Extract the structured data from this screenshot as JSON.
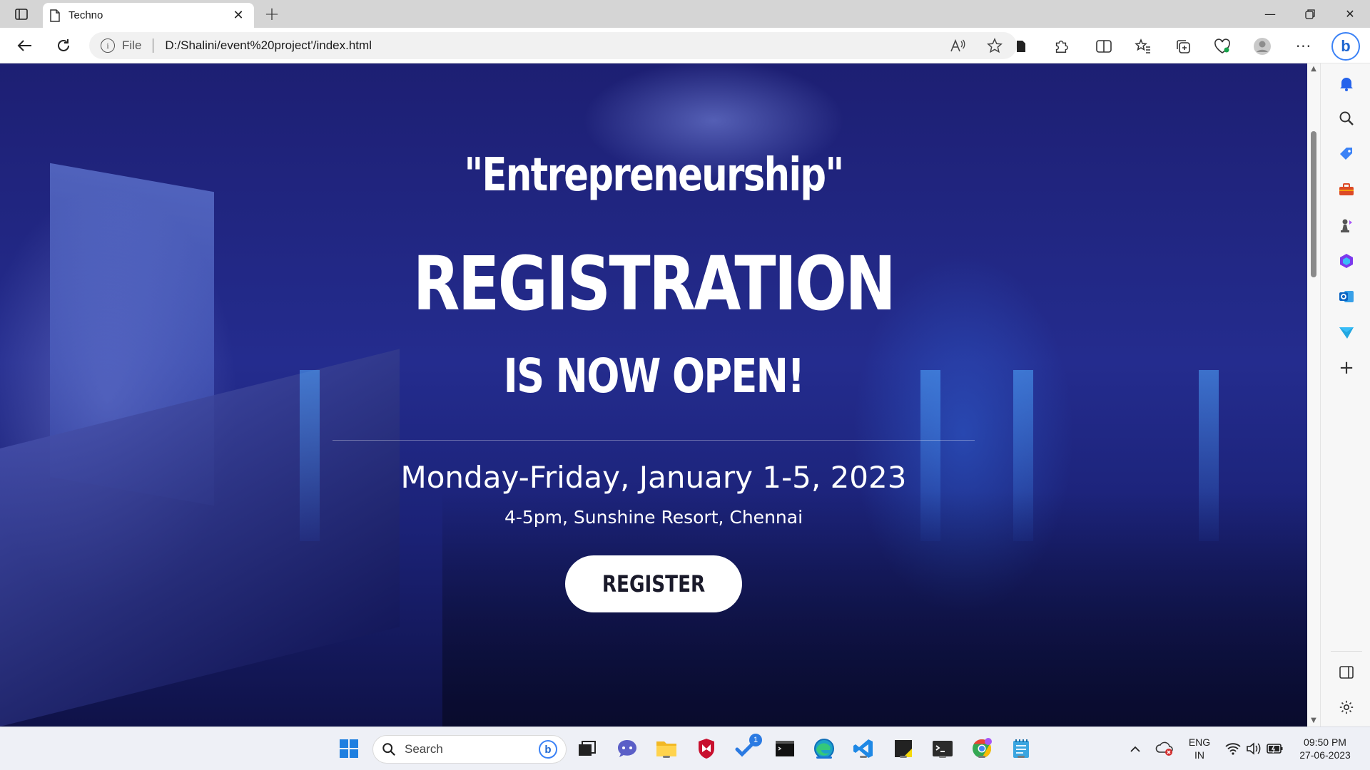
{
  "browser": {
    "tab": {
      "title": "Techno"
    },
    "address": {
      "scheme": "File",
      "url": "D:/Shalini/event%20project'/index.html"
    }
  },
  "page": {
    "subtitle": "\"Entrepreneurship\"",
    "headline": "REGISTRATION",
    "headline2": "IS NOW OPEN!",
    "dates": "Monday-Friday, January 1-5, 2023",
    "venue": "4-5pm, Sunshine Resort, Chennai",
    "register_label": "REGISTER"
  },
  "taskbar": {
    "search_label": "Search",
    "language": {
      "line1": "ENG",
      "line2": "IN"
    },
    "clock": {
      "time": "09:50 PM",
      "date": "27-06-2023"
    },
    "todo_badge": "1"
  },
  "colors": {
    "page_bg": "#1d1f73",
    "button_bg": "#ffffff",
    "accent": "#1a73d6"
  }
}
